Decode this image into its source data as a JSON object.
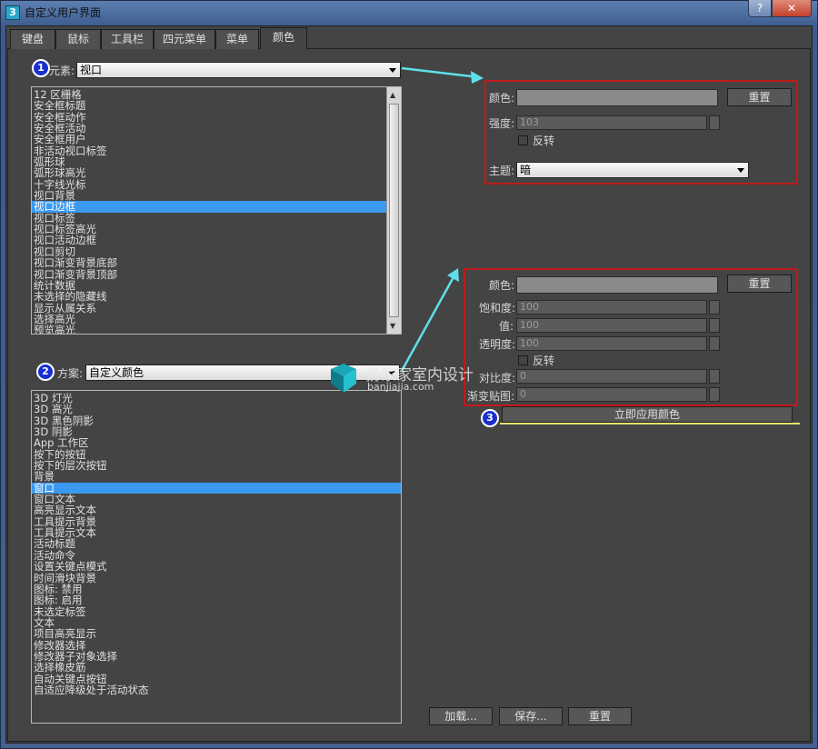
{
  "window": {
    "title": "自定义用户界面",
    "icon_label": "3",
    "help_label": "?",
    "close_label": "✕"
  },
  "tabs": [
    "键盘",
    "鼠标",
    "工具栏",
    "四元菜单",
    "菜单",
    "颜色"
  ],
  "active_tab": "颜色",
  "elements": {
    "label": "元素:",
    "selected": "视口",
    "items": [
      "12 区栅格",
      "安全框标题",
      "安全框动作",
      "安全框活动",
      "安全框用户",
      "非活动视口标签",
      "弧形球",
      "弧形球高光",
      "十字线光标",
      "视口背景",
      "视口边框",
      "视口标签",
      "视口标签高光",
      "视口活动边框",
      "视口剪切",
      "视口渐变背景底部",
      "视口渐变背景顶部",
      "统计数据",
      "未选择的隐藏线",
      "显示从属关系",
      "选择高光",
      "预览高光"
    ],
    "selected_item": "视口边框"
  },
  "element_color": {
    "color_label": "颜色:",
    "reset_label": "重置",
    "intensity_label": "强度:",
    "intensity_value": "103",
    "invert_label": "反转",
    "theme_label": "主题:",
    "theme_value": "暗"
  },
  "scheme": {
    "label": "方案:",
    "selected": "自定义颜色",
    "items": [
      "3D 灯光",
      "3D 高光",
      "3D 黑色阴影",
      "3D 阴影",
      "App 工作区",
      "按下的按钮",
      "按下的层次按钮",
      "背景",
      "窗口",
      "窗口文本",
      "高亮显示文本",
      "工具提示背景",
      "工具提示文本",
      "活动标题",
      "活动命令",
      "设置关键点模式",
      "时间滑块背景",
      "图标: 禁用",
      "图标: 启用",
      "未选定标签",
      "文本",
      "项目高亮显示",
      "修改器选择",
      "修改器子对象选择",
      "选择橡皮筋",
      "自动关键点按钮",
      "自适应降级处于活动状态"
    ],
    "selected_item": "窗口"
  },
  "scheme_color": {
    "color_label": "颜色:",
    "reset_label": "重置",
    "saturation_label": "饱和度:",
    "saturation_value": "100",
    "value_label": "值:",
    "value_value": "100",
    "transparency_label": "透明度:",
    "transparency_value": "100",
    "invert_label": "反转",
    "contrast_label": "对比度:",
    "contrast_value": "0",
    "gradient_label": "渐变贴图:",
    "gradient_value": "0"
  },
  "apply_label": "立即应用颜色",
  "footer": {
    "load_label": "加载...",
    "save_label": "保存...",
    "reset_label": "重置"
  },
  "annotations": {
    "badge1": "1",
    "badge2": "2",
    "badge3": "3"
  },
  "watermark": {
    "text": "扮家家室内设计",
    "url": "banjiajia.com"
  },
  "colors": {
    "selection": "#3b99f0",
    "annotation_red": "#c01a1a",
    "arrow_cyan": "#5fe0e8",
    "badge_blue": "#1a2fd0",
    "underline_yellow": "#e8e070"
  }
}
